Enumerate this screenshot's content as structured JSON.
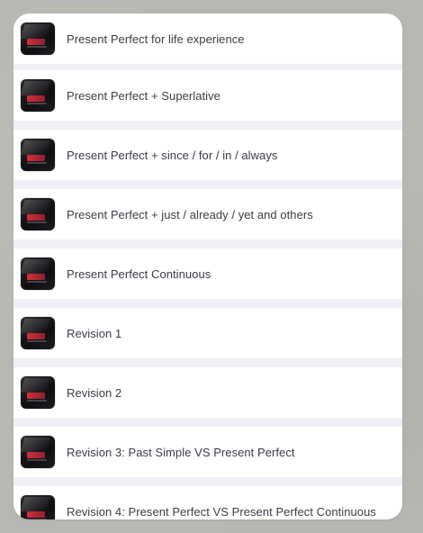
{
  "app": {
    "title": ""
  },
  "lessons": [
    {
      "label": "Present Perfect for life experience",
      "thumbnail_icon": "lesson-thumbnail-icon"
    },
    {
      "label": "Present Perfect + Superlative",
      "thumbnail_icon": "lesson-thumbnail-icon"
    },
    {
      "label": "Present Perfect + since / for / in / always",
      "thumbnail_icon": "lesson-thumbnail-icon"
    },
    {
      "label": "Present Perfect + just / already / yet and others",
      "thumbnail_icon": "lesson-thumbnail-icon"
    },
    {
      "label": "Present Perfect Continuous",
      "thumbnail_icon": "lesson-thumbnail-icon"
    },
    {
      "label": "Revision 1",
      "thumbnail_icon": "lesson-thumbnail-icon"
    },
    {
      "label": "Revision 2",
      "thumbnail_icon": "lesson-thumbnail-icon"
    },
    {
      "label": "Revision 3: Past Simple VS Present Perfect",
      "thumbnail_icon": "lesson-thumbnail-icon"
    },
    {
      "label": "Revision 4: Present Perfect VS Present Perfect Continuous",
      "thumbnail_icon": "lesson-thumbnail-icon"
    }
  ],
  "colors": {
    "background": "#b9b7b2",
    "panel": "#eef0f5",
    "row": "#ffffff",
    "text": "#3a3d46",
    "thumbnail_accent": "#d62d3a"
  }
}
